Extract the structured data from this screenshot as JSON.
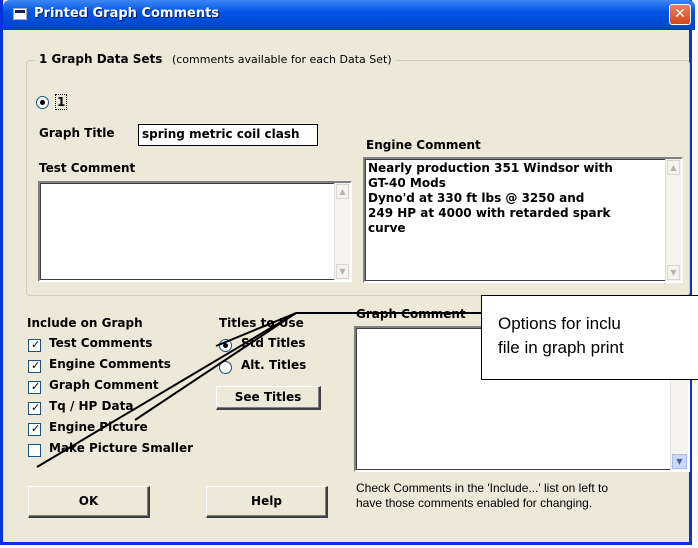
{
  "window": {
    "title": "Printed Graph Comments",
    "close_label": "✕",
    "title_icon": "window-icon"
  },
  "data_sets": {
    "heading": "1 Graph Data Sets",
    "note": "(comments available for each Data Set)",
    "options": [
      "1"
    ],
    "selected": "1"
  },
  "graph_title": {
    "label": "Graph Title",
    "value": "spring metric coil clash"
  },
  "test_comment": {
    "label": "Test Comment",
    "value": ""
  },
  "engine_comment": {
    "label": "Engine Comment",
    "lines": [
      "Nearly production 351 Windsor with",
      "GT-40 Mods",
      "Dyno'd at 330 ft lbs @ 3250 and",
      "249 HP at 4000 with retarded spark",
      "curve"
    ]
  },
  "include_on_graph": {
    "heading": "Include on Graph",
    "items": [
      {
        "label": "Test Comments",
        "checked": true
      },
      {
        "label": "Engine Comments",
        "checked": true
      },
      {
        "label": "Graph Comment",
        "checked": true
      },
      {
        "label": "Tq / HP Data",
        "checked": true
      },
      {
        "label": "Engine Picture",
        "checked": true
      },
      {
        "label": "Make Picture Smaller",
        "checked": false
      }
    ]
  },
  "titles_to_use": {
    "heading": "Titles to Use",
    "options": [
      {
        "label": "Std Titles",
        "selected": true
      },
      {
        "label": "Alt. Titles",
        "selected": false
      }
    ],
    "see_titles_label": "See Titles"
  },
  "graph_comment": {
    "label": "Graph Comment",
    "value": "",
    "hint_line1": "Check Comments in the 'Include...' list on left to",
    "hint_line2": "have those comments enabled for changing."
  },
  "buttons": {
    "ok": "OK",
    "help": "Help"
  },
  "callout": {
    "line1": "Options for inclu",
    "line2": "file in graph print"
  },
  "colors": {
    "dialog_bg": "#ece9d8",
    "titlebar": "#0054e3",
    "close": "#d4461e"
  }
}
